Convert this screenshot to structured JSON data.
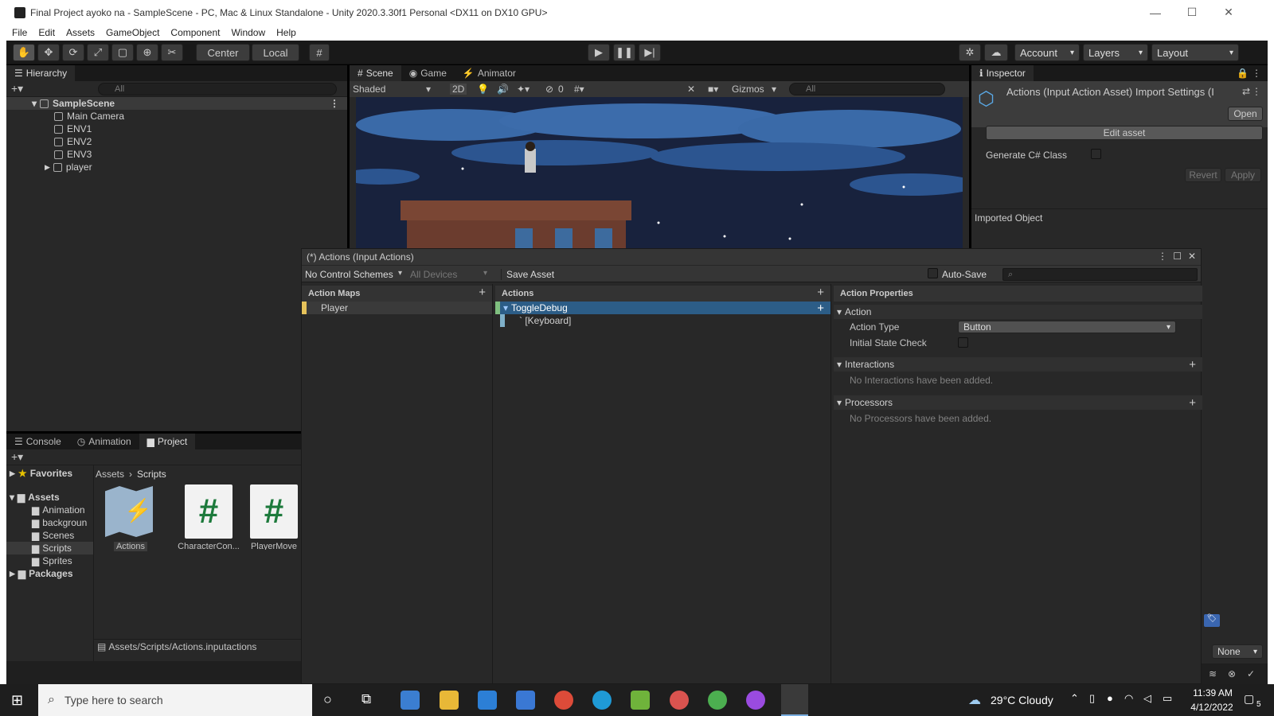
{
  "window": {
    "title": "Final Project ayoko na - SampleScene - PC, Mac & Linux Standalone - Unity 2020.3.30f1 Personal <DX11 on DX10 GPU>",
    "minimize": "—",
    "maximize": "☐",
    "close": "✕"
  },
  "menu": [
    "File",
    "Edit",
    "Assets",
    "GameObject",
    "Component",
    "Window",
    "Help"
  ],
  "toolbar": {
    "pivot": "Center",
    "space": "Local",
    "account": "Account",
    "layers": "Layers",
    "layout": "Layout"
  },
  "hierarchy": {
    "tab": "Hierarchy",
    "search_placeholder": "All",
    "scene": "SampleScene",
    "items": [
      "Main Camera",
      "ENV1",
      "ENV2",
      "ENV3",
      "player"
    ]
  },
  "scene_view": {
    "tabs": [
      "Scene",
      "Game",
      "Animator"
    ],
    "shading": "Shaded",
    "mode_2d": "2D",
    "hidden_count": "0",
    "gizmos": "Gizmos",
    "search_placeholder": "All"
  },
  "inspector": {
    "tab": "Inspector",
    "title": "Actions (Input Action Asset) Import Settings (I",
    "open": "Open",
    "edit_asset": "Edit asset",
    "generate_label": "Generate C# Class",
    "revert": "Revert",
    "apply": "Apply",
    "imported_object": "Imported Object",
    "bundle_value": "None"
  },
  "bottom": {
    "tabs": [
      "Console",
      "Animation",
      "Project"
    ],
    "favorites": "Favorites",
    "assets": "Assets",
    "folders": [
      "Animation",
      "backgroun",
      "Scenes",
      "Scripts",
      "Sprites"
    ],
    "packages": "Packages",
    "breadcrumb": [
      "Assets",
      "Scripts"
    ],
    "files": [
      "Actions",
      "CharacterCon...",
      "PlayerMove"
    ],
    "path": "Assets/Scripts/Actions.inputactions"
  },
  "input_actions": {
    "title": "(*) Actions (Input Actions)",
    "control_schemes": "No Control Schemes",
    "devices": "All Devices",
    "save": "Save Asset",
    "auto_save": "Auto-Save",
    "col_maps": "Action Maps",
    "col_actions": "Actions",
    "col_props": "Action Properties",
    "map": "Player",
    "action": "ToggleDebug",
    "binding": "` [Keyboard]",
    "section_action": "Action",
    "action_type_label": "Action Type",
    "action_type_value": "Button",
    "initial_state": "Initial State Check",
    "section_interactions": "Interactions",
    "no_interactions": "No Interactions have been added.",
    "section_processors": "Processors",
    "no_processors": "No Processors have been added."
  },
  "taskbar": {
    "search_placeholder": "Type here to search",
    "weather": "29°C  Cloudy",
    "time": "11:39 AM",
    "date": "4/12/2022",
    "notifications": "5"
  }
}
